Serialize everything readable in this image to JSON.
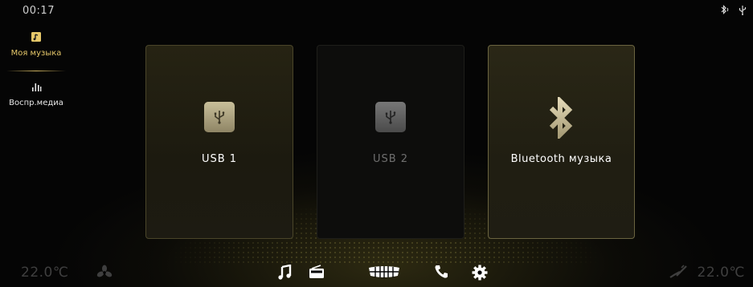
{
  "status": {
    "time": "00:17",
    "icons": [
      "bluetooth-icon",
      "usb-icon"
    ]
  },
  "sidebar": {
    "items": [
      {
        "label": "Моя музыка",
        "icon": "music-note-box-icon",
        "active": true
      },
      {
        "label": "Воспр.медиа",
        "icon": "equalizer-bars-icon",
        "active": false
      }
    ]
  },
  "sources": [
    {
      "label": "USB 1",
      "icon": "usb-icon",
      "enabled": true
    },
    {
      "label": "USB 2",
      "icon": "usb-icon",
      "enabled": false
    },
    {
      "label": "Bluetooth музыка",
      "icon": "bluetooth-icon",
      "enabled": true
    }
  ],
  "bottom_bar": {
    "left_temp": "22.0℃",
    "right_temp": "22.0℃",
    "dock_icons": [
      "music-note-icon",
      "radio-icon",
      "car-grille-icon",
      "phone-icon",
      "settings-gear-icon"
    ]
  },
  "colors": {
    "accent": "#e6c86a",
    "disabled": "#6f6f6f",
    "temp": "#3f3f3f"
  }
}
